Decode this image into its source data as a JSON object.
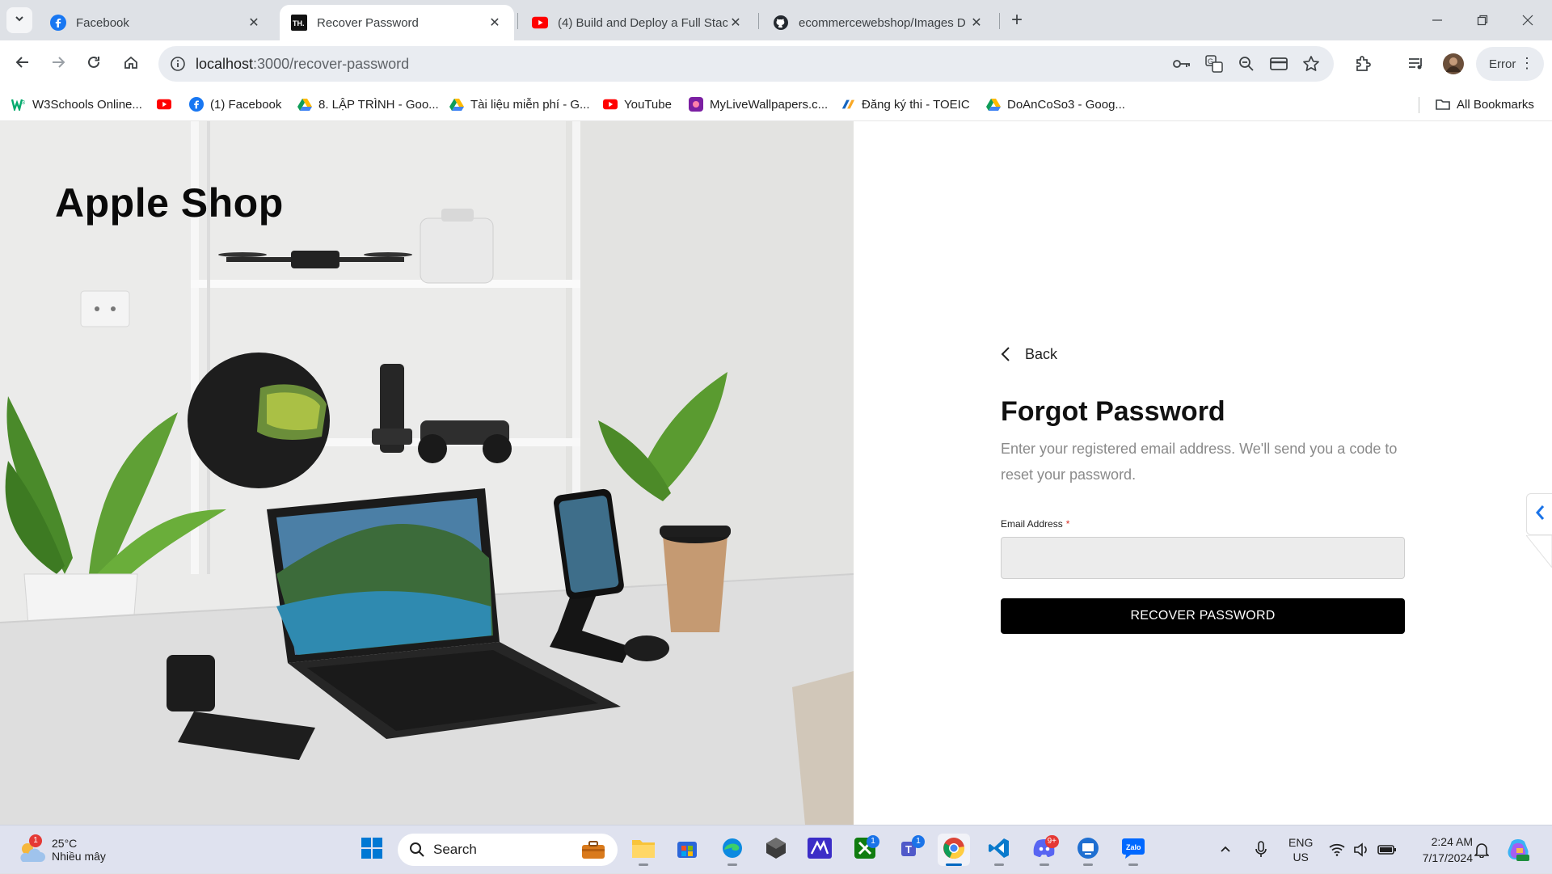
{
  "browser": {
    "tabs": [
      {
        "title": "Facebook",
        "active": false
      },
      {
        "title": "Recover Password",
        "active": true
      },
      {
        "title": "(4) Build and Deploy a Full Stac",
        "active": false
      },
      {
        "title": "ecommercewebshop/Images D",
        "active": false
      }
    ],
    "url_host": "localhost",
    "url_path": ":3000/recover-password",
    "profile_chip": "Error",
    "bookmarks": [
      {
        "label": "W3Schools Online...",
        "icon": "w3schools-icon"
      },
      {
        "label": "",
        "icon": "youtube-icon"
      },
      {
        "label": "(1) Facebook",
        "icon": "facebook-icon"
      },
      {
        "label": "8. LẬP TRÌNH - Goo...",
        "icon": "google-drive-icon"
      },
      {
        "label": "Tài liệu miễn phí - G...",
        "icon": "google-drive-icon"
      },
      {
        "label": "YouTube",
        "icon": "youtube-icon"
      },
      {
        "label": "MyLiveWallpapers.c...",
        "icon": "wallpaper-icon"
      },
      {
        "label": "Đăng ký thi - TOEIC",
        "icon": "toeic-icon"
      },
      {
        "label": "DoAnCoSo3 - Goog...",
        "icon": "google-drive-icon"
      }
    ],
    "all_bookmarks": "All Bookmarks"
  },
  "page": {
    "brand": "Apple Shop",
    "back_label": "Back",
    "title": "Forgot Password",
    "description": "Enter your registered email address. We'll send you a code to reset your password.",
    "email_label": "Email Address",
    "email_required_mark": "*",
    "email_value": "",
    "email_placeholder": "",
    "submit_label": "RECOVER PASSWORD"
  },
  "taskbar": {
    "weather_temp": "25°C",
    "weather_condition": "Nhiều mây",
    "weather_badge": "1",
    "search_label": "Search",
    "xbox_badge": "1",
    "teams_badge": "1",
    "discord_badge": "9+",
    "language": "ENG",
    "region": "US",
    "time": "2:24 AM",
    "date": "7/17/2024"
  },
  "colors": {
    "accent": "#000000",
    "tab_strip": "#dee1e6",
    "omnibox": "#e9ecf1",
    "taskbar": "#dfe2ef",
    "required": "#d93025"
  }
}
